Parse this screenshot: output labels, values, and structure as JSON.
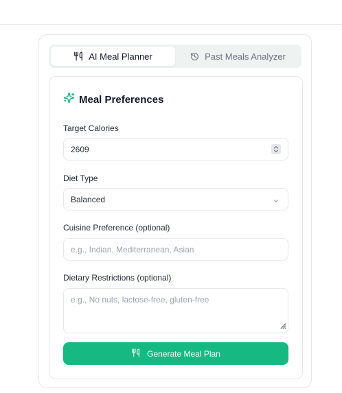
{
  "tabs": [
    {
      "label": "AI Meal Planner",
      "icon": "utensils-icon",
      "active": true
    },
    {
      "label": "Past Meals Analyzer",
      "icon": "history-icon",
      "active": false
    }
  ],
  "preferences": {
    "heading": "Meal Preferences",
    "heading_icon": "sparkles-icon",
    "target_calories_label": "Target Calories",
    "target_calories_value": "2609",
    "diet_type_label": "Diet Type",
    "diet_type_value": "Balanced",
    "cuisine_label": "Cuisine Preference (optional)",
    "cuisine_placeholder": "e.g., Indian, Mediterranean, Asian",
    "restrictions_label": "Dietary Restrictions (optional)",
    "restrictions_placeholder": "e.g., No nuts, lactose-free, gluten-free"
  },
  "generate_button": {
    "label": "Generate Meal Plan",
    "icon": "utensils-icon"
  },
  "colors": {
    "accent": "#16b981",
    "border": "#e5e7eb",
    "tab_bg": "#eef2f1"
  }
}
